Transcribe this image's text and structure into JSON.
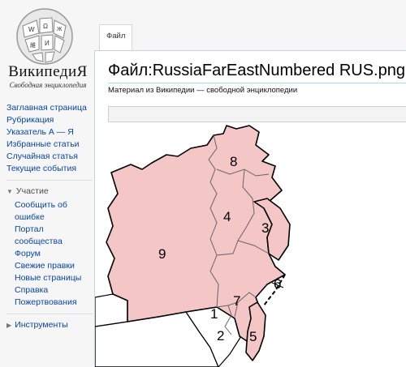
{
  "logo": {
    "wordmark": "ВикипедиЯ",
    "tagline": "Свободная энциклопедия"
  },
  "sidebar": {
    "nav": [
      {
        "label": "Заглавная страница"
      },
      {
        "label": "Рубрикация"
      },
      {
        "label": "Указатель А — Я"
      },
      {
        "label": "Избранные статьи"
      },
      {
        "label": "Случайная статья"
      },
      {
        "label": "Текущие события"
      }
    ],
    "participation": {
      "heading": "Участие",
      "items": [
        {
          "label": "Сообщить об ошибке"
        },
        {
          "label": "Портал сообщества"
        },
        {
          "label": "Форум"
        },
        {
          "label": "Свежие правки"
        },
        {
          "label": "Новые страницы"
        },
        {
          "label": "Справка"
        },
        {
          "label": "Пожертвования"
        }
      ]
    },
    "tools": {
      "heading": "Инструменты"
    }
  },
  "tabs": [
    {
      "label": "Файл"
    }
  ],
  "page": {
    "title": "Файл:RussiaFarEastNumbered RUS.png",
    "subtitle": "Материал из Википедии — свободной энциклопедии"
  },
  "map": {
    "region_fill": "#f4c6c6",
    "labels": [
      "8",
      "4",
      "3",
      "9",
      "6",
      "7",
      "1",
      "2",
      "5"
    ]
  },
  "colors": {
    "link": "#0645ad",
    "accent_border": "#a7d7f9"
  }
}
